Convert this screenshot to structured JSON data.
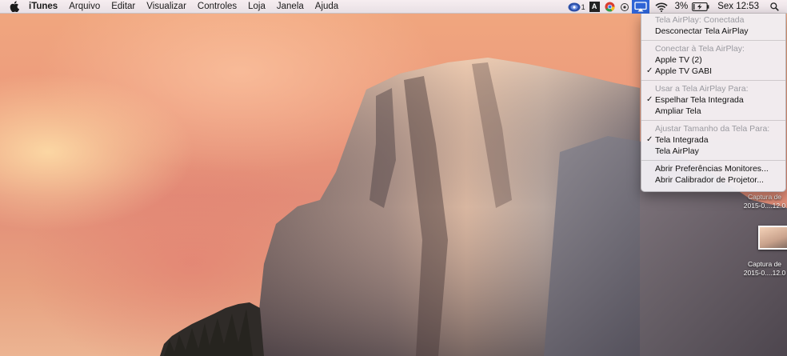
{
  "menubar": {
    "app_name": "iTunes",
    "menus": [
      "Arquivo",
      "Editar",
      "Visualizar",
      "Controles",
      "Loja",
      "Janela",
      "Ajuda"
    ],
    "status": {
      "notification_count": "1",
      "adobe_label": "A",
      "battery_percent": "3%",
      "clock": "Sex 12:53"
    }
  },
  "airplay_menu": {
    "sections": [
      {
        "header": "Tela AirPlay: Conectada",
        "items": [
          {
            "label": "Desconectar Tela AirPlay",
            "checked": false
          }
        ]
      },
      {
        "header": "Conectar à Tela AirPlay:",
        "items": [
          {
            "label": "Apple TV (2)",
            "checked": false
          },
          {
            "label": "Apple TV GABI",
            "checked": true
          }
        ]
      },
      {
        "header": "Usar a Tela AirPlay Para:",
        "items": [
          {
            "label": "Espelhar Tela Integrada",
            "checked": true
          },
          {
            "label": "Ampliar Tela",
            "checked": false
          }
        ]
      },
      {
        "header": "Ajustar Tamanho da Tela Para:",
        "items": [
          {
            "label": "Tela Integrada",
            "checked": true
          },
          {
            "label": "Tela AirPlay",
            "checked": false
          }
        ]
      },
      {
        "header": "",
        "items": [
          {
            "label": "Abrir Preferências Monitores...",
            "checked": false
          },
          {
            "label": "Abrir Calibrador de Projetor...",
            "checked": false
          }
        ]
      }
    ],
    "check_glyph": "✓"
  },
  "desktop_icons": [
    {
      "line1": "Captura de",
      "line2": "2015-0....12.0"
    },
    {
      "line1": "Captura de",
      "line2": "2015-0....12.0"
    }
  ],
  "colors": {
    "airplay_active": "#2f64d6",
    "menu_header_text": "#9a9aa0"
  },
  "icons": {
    "apple": "apple-logo-icon",
    "notification": "notification-badge-icon",
    "adobe": "adobe-icon",
    "chrome": "chrome-icon",
    "airplay": "airplay-icon",
    "wifi": "wifi-icon",
    "battery": "battery-charging-icon",
    "search": "spotlight-search-icon"
  }
}
